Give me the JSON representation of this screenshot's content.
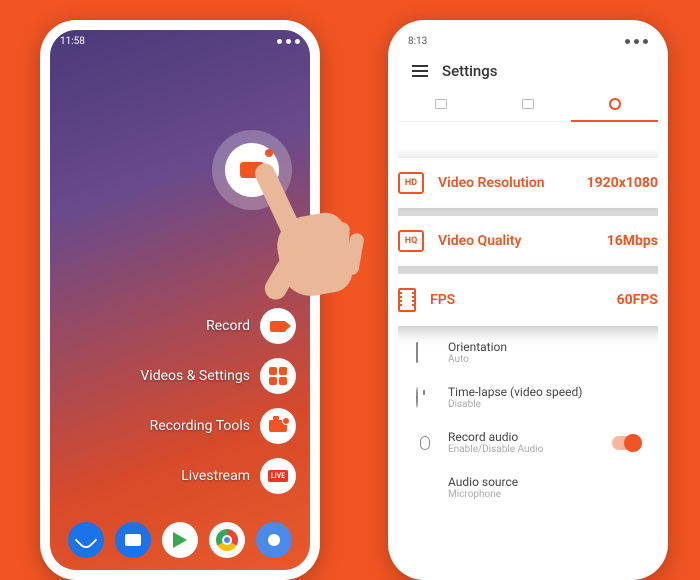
{
  "left_phone": {
    "status_time": "11:58",
    "menu": {
      "record": "Record",
      "videos_settings": "Videos & Settings",
      "recording_tools": "Recording Tools",
      "livestream": "Livestream",
      "live_badge": "LIVE"
    }
  },
  "right_phone": {
    "status_time": "8:13",
    "settings_title": "Settings",
    "cards": {
      "resolution": {
        "icon_text": "HD",
        "label": "Video Resolution",
        "value": "1920x1080"
      },
      "quality": {
        "icon_text": "HQ",
        "label": "Video Quality",
        "value": "16Mbps"
      },
      "fps": {
        "label": "FPS",
        "value": "60FPS"
      }
    },
    "rows": {
      "orientation": {
        "title": "Orientation",
        "sub": "Auto"
      },
      "timelapse": {
        "title": "Time-lapse (video speed)",
        "sub": "Disable"
      },
      "record_audio": {
        "title": "Record audio",
        "sub": "Enable/Disable Audio"
      },
      "audio_source": {
        "title": "Audio source",
        "sub": "Microphone"
      }
    }
  }
}
